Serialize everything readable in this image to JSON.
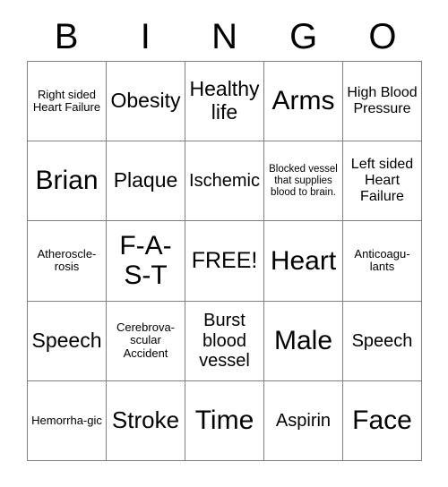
{
  "card": {
    "title_letters": [
      "B",
      "I",
      "N",
      "G",
      "O"
    ],
    "border_color": "#808080",
    "background_color": "#ffffff",
    "text_color": "#000000",
    "rows": [
      [
        {
          "text": "Right sided Heart Failure",
          "size": "xs"
        },
        {
          "text": "Obesity",
          "size": "lg"
        },
        {
          "text": "Healthy life",
          "size": "lg"
        },
        {
          "text": "Arms",
          "size": "xxl"
        },
        {
          "text": "High Blood Pressure",
          "size": "sm"
        }
      ],
      [
        {
          "text": "Brian",
          "size": "xxl"
        },
        {
          "text": "Plaque",
          "size": "lg"
        },
        {
          "text": "Ischemic",
          "size": "md"
        },
        {
          "text": "Blocked vessel that supplies blood to brain.",
          "size": "xxs"
        },
        {
          "text": "Left sided Heart Failure",
          "size": "sm"
        }
      ],
      [
        {
          "text": "Atheroscle-rosis",
          "size": "xs"
        },
        {
          "text": "F-A-S-T",
          "size": "xxl"
        },
        {
          "text": "FREE!",
          "size": "free"
        },
        {
          "text": "Heart",
          "size": "xxl"
        },
        {
          "text": "Anticoagu-lants",
          "size": "xs"
        }
      ],
      [
        {
          "text": "Speech",
          "size": "lg"
        },
        {
          "text": "Cerebrova-scular Accident",
          "size": "xs"
        },
        {
          "text": "Burst blood vessel",
          "size": "md"
        },
        {
          "text": "Male",
          "size": "xxl"
        },
        {
          "text": "Speech",
          "size": "md"
        }
      ],
      [
        {
          "text": "Hemorrha-gic",
          "size": "xs"
        },
        {
          "text": "Stroke",
          "size": "xl"
        },
        {
          "text": "Time",
          "size": "xxl"
        },
        {
          "text": "Aspirin",
          "size": "md"
        },
        {
          "text": "Face",
          "size": "xxl"
        }
      ]
    ]
  }
}
